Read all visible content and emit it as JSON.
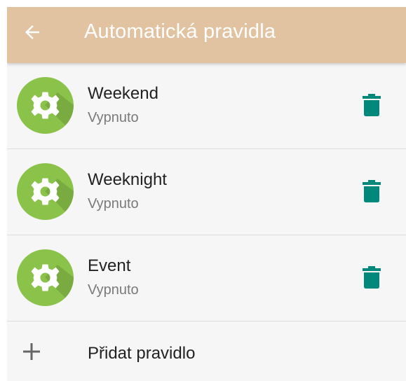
{
  "header": {
    "title": "Automatická pravidla",
    "back_icon": "arrow-back-icon",
    "color": "#e2c3a1"
  },
  "rules": [
    {
      "name": "Weekend",
      "status": "Vypnuto"
    },
    {
      "name": "Weeknight",
      "status": "Vypnuto"
    },
    {
      "name": "Event",
      "status": "Vypnuto"
    }
  ],
  "rule_icon": "gear-icon",
  "rule_icon_color": "#8bc34a",
  "delete_icon": "trash-icon",
  "delete_icon_color": "#00897b",
  "add_rule": {
    "label": "Přidat pravidlo",
    "icon": "plus-icon"
  }
}
